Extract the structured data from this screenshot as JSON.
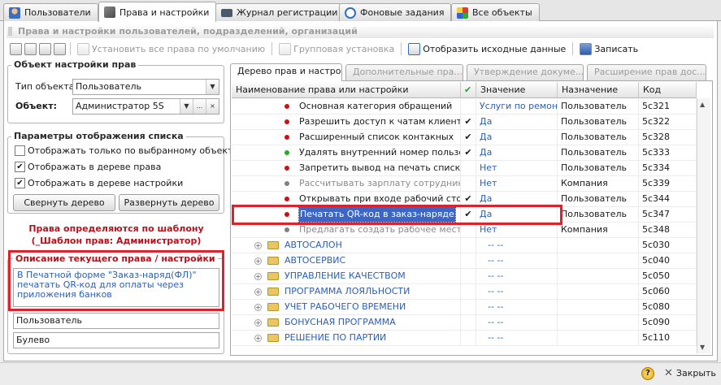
{
  "tabs": [
    {
      "label": "Пользователи",
      "icon": "users-icon",
      "active": false
    },
    {
      "label": "Права и настройки",
      "icon": "rights-icon",
      "active": true
    },
    {
      "label": "Журнал регистрации",
      "icon": "journal-icon",
      "active": false
    },
    {
      "label": "Фоновые задания",
      "icon": "clock-icon",
      "active": false
    },
    {
      "label": "Все объекты",
      "icon": "objects-icon",
      "active": false
    }
  ],
  "title": "Права и настройки пользователей, подразделений, организаций",
  "toolbar": {
    "set_default": "Установить все права по умолчанию",
    "group_install": "Групповая установка",
    "show_source": "Отобразить исходные данные",
    "write": "Записать"
  },
  "object_group": {
    "title": "Объект настройки прав",
    "type_label": "Тип объекта:",
    "type_value": "Пользователь",
    "object_label": "Объект:",
    "object_value": "Администратор 5S",
    "ellipsis": "...",
    "clear": "×"
  },
  "display_group": {
    "title": "Параметры отображения списка",
    "only_selected": "Отображать только по  выбранному объекту",
    "in_rights_tree": "Отображать в дереве права",
    "in_settings_tree": "Отображать в дереве настройки",
    "collapse": "Свернуть дерево",
    "expand": "Развернуть дерево",
    "checkbox_states": [
      false,
      true,
      true
    ]
  },
  "template_notice": "Права определяются по шаблону (_Шаблон прав: Администратор)",
  "description": {
    "title": "Описание текущего права / настройки",
    "text": "В Печатной форме \"Заказ-наряд(ФЛ)\" печатать QR-код для оплаты через приложения банков",
    "field1": "Пользователь",
    "field2": "Булево"
  },
  "right_tabs": [
    {
      "label": "Дерево прав и настро...",
      "active": true
    },
    {
      "label": "Дополнительные пра...",
      "active": false
    },
    {
      "label": "Утверждение докуме...",
      "active": false
    },
    {
      "label": "Расширение прав дос...",
      "active": false
    }
  ],
  "grid": {
    "headers": {
      "name": "Наименование права или настройки",
      "check": "✔",
      "value": "Значение",
      "dest": "Назначение",
      "code": "Код"
    },
    "rows": [
      {
        "name": "Основная категория обращений",
        "dot": "#d01010",
        "check": "",
        "value": "Услуги по ремон...",
        "dest": "Пользователь",
        "code": "5c321",
        "muted": false,
        "sel": false
      },
      {
        "name": "Разрешить доступ к чатам клиентов",
        "dot": "#d01010",
        "check": "✔",
        "value": "Да",
        "dest": "Пользователь",
        "code": "5c322",
        "muted": false,
        "sel": false
      },
      {
        "name": "Расширенный список контакных",
        "dot": "#d01010",
        "check": "✔",
        "value": "Да",
        "dest": "Пользователь",
        "code": "5c328",
        "muted": false,
        "sel": false
      },
      {
        "name": "Удалять внутренний номер пользов...",
        "dot": "#20b020",
        "check": "✔",
        "value": "Да",
        "dest": "Пользователь",
        "code": "5c333",
        "muted": false,
        "sel": false
      },
      {
        "name": "Запретить вывод на печать списка к...",
        "dot": "#d01010",
        "check": "",
        "value": "Нет",
        "dest": "Пользователь",
        "code": "5c334",
        "muted": false,
        "sel": false
      },
      {
        "name": "Рассчитывать зарплату сотрудника...",
        "dot": "#808080",
        "check": "",
        "value": "Нет",
        "dest": "Компания",
        "code": "5c339",
        "muted": true,
        "sel": false
      },
      {
        "name": "Открывать при входе рабочий стол",
        "dot": "#d01010",
        "check": "✔",
        "value": "Да",
        "dest": "Пользователь",
        "code": "5c344",
        "muted": false,
        "sel": false
      },
      {
        "name": "Печатать QR-код в заказ-наряде",
        "dot": "#d01010",
        "check": "✔",
        "value": "Да",
        "dest": "Пользователь",
        "code": "5c347",
        "muted": false,
        "sel": true
      },
      {
        "name": "Предлагать создать рабочее место ...",
        "dot": "#808080",
        "check": "",
        "value": "Нет",
        "dest": "Компания",
        "code": "5c348",
        "muted": true,
        "sel": false
      }
    ],
    "groups": [
      {
        "name": "АВТОСАЛОН",
        "value": "-- --",
        "code": "5c030"
      },
      {
        "name": "АВТОСЕРВИС",
        "value": "-- --",
        "code": "5c040"
      },
      {
        "name": "УПРАВЛЕНИЕ КАЧЕСТВОМ",
        "value": "-- --",
        "code": "5c050"
      },
      {
        "name": "ПРОГРАММА ЛОЯЛЬНОСТИ",
        "value": "-- --",
        "code": "5c060"
      },
      {
        "name": "УЧЕТ РАБОЧЕГО ВРЕМЕНИ",
        "value": "-- --",
        "code": "5c080"
      },
      {
        "name": "БОНУСНАЯ ПРОГРАММА",
        "value": "-- --",
        "code": "5c090"
      },
      {
        "name": "РЕШЕНИЕ ПО ПАРТИИ",
        "value": "-- --",
        "code": "5c110"
      }
    ]
  },
  "footer": {
    "help": "?",
    "close": "Закрыть"
  },
  "colors": {
    "accent_link": "#2b5fb5",
    "warning": "#b5121b",
    "highlight": "#e0202a"
  }
}
